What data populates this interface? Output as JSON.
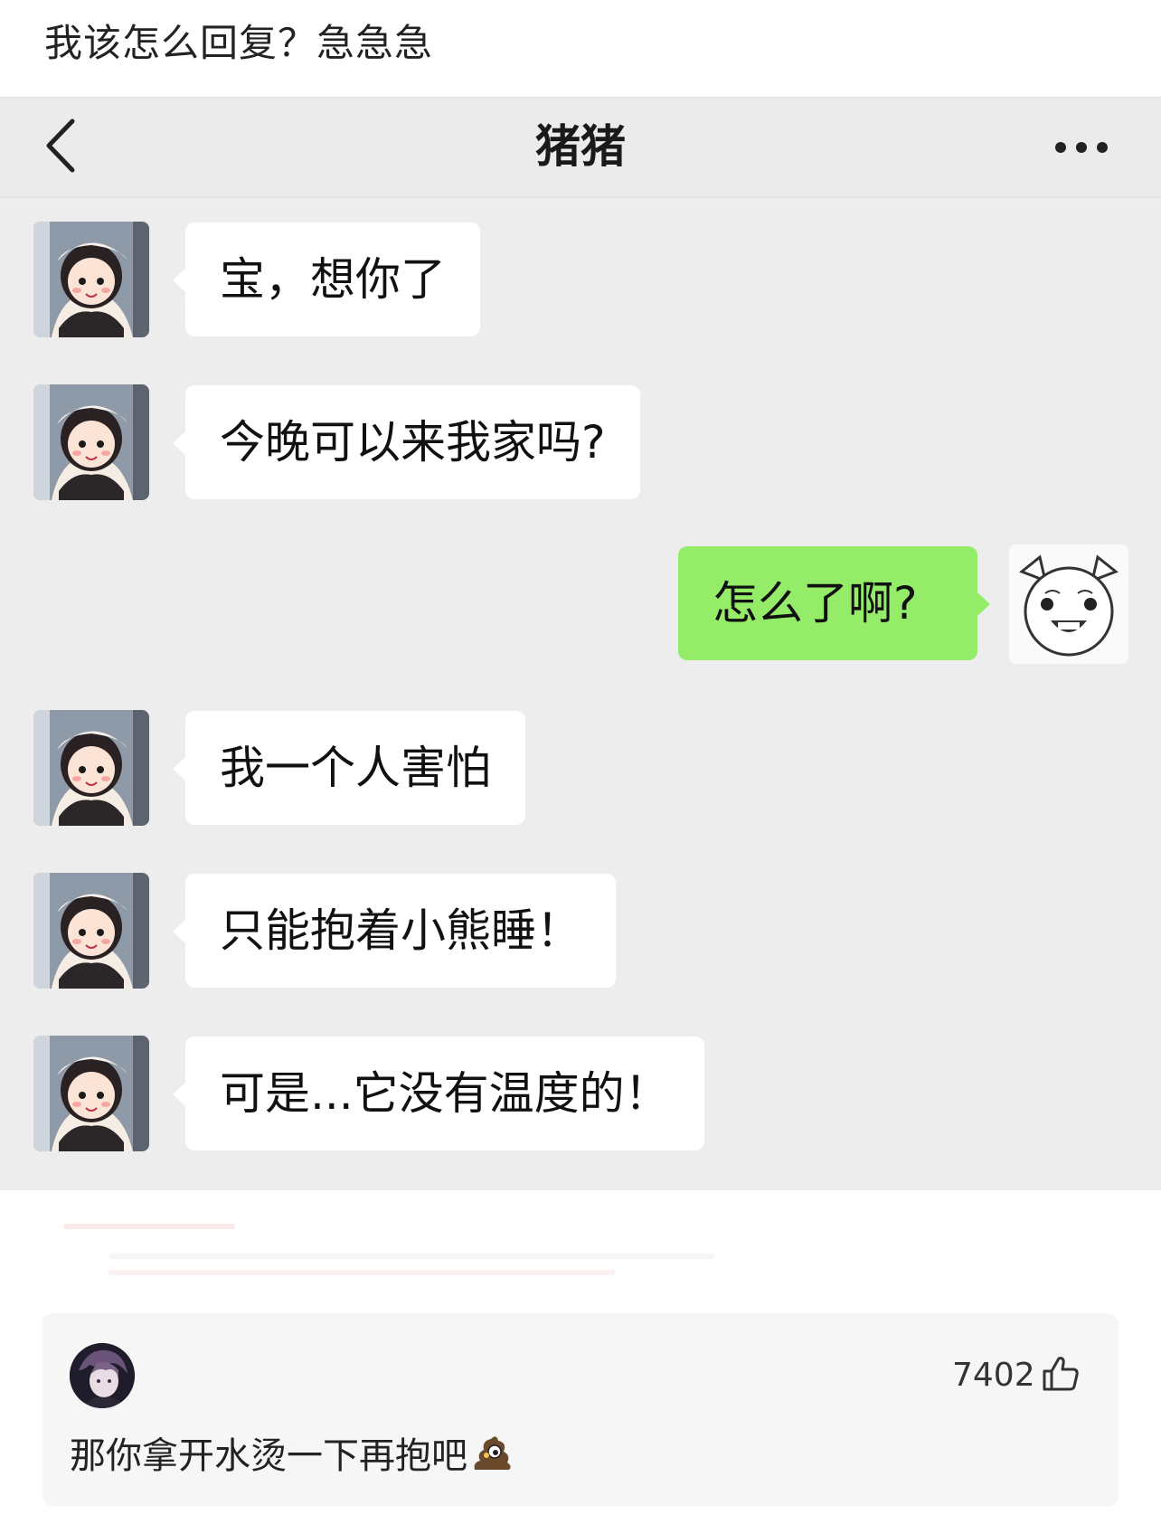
{
  "post": {
    "title": "我该怎么回复？急急急"
  },
  "chat": {
    "contact_name": "猪猪",
    "back_icon": "chevron-left-icon",
    "more_icon": "more-dots-icon",
    "colors": {
      "background": "#ededed",
      "incoming_bubble": "#ffffff",
      "outgoing_bubble": "#95ec69"
    },
    "messages": [
      {
        "side": "left",
        "text": "宝，想你了"
      },
      {
        "side": "left",
        "text": "今晚可以来我家吗?"
      },
      {
        "side": "right",
        "text": "怎么了啊?"
      },
      {
        "side": "left",
        "text": "我一个人害怕"
      },
      {
        "side": "left",
        "text": "只能抱着小熊睡！"
      },
      {
        "side": "left",
        "text": "可是...它没有温度的！"
      }
    ]
  },
  "comment": {
    "likes": "7402",
    "like_icon": "thumbs-up-icon",
    "text": "那你拿开水烫一下再抱吧",
    "emoji": "poop-emoji-icon"
  }
}
